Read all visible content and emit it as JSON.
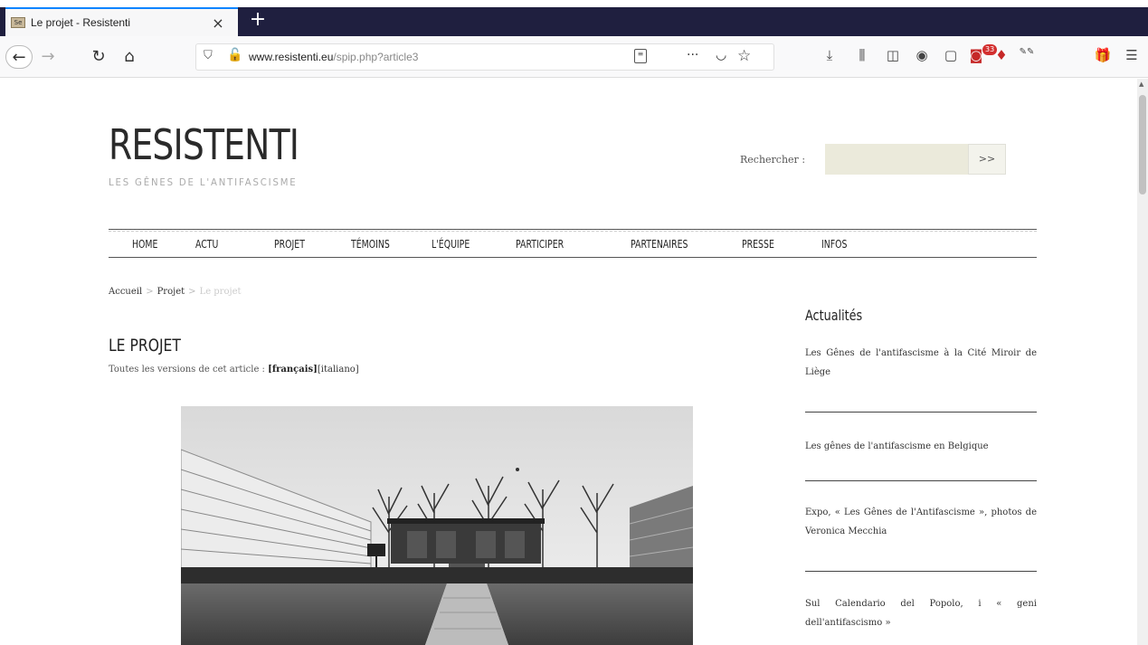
{
  "browser": {
    "tab_title": "Le projet - Resistenti",
    "favicon_text": "Se",
    "close_glyph": "×",
    "newtab_glyph": "+",
    "url_domain": "www.resistenti.eu",
    "url_path": "/spip.php?article3",
    "extension_badge": "33"
  },
  "site": {
    "logo": "RESISTENTI",
    "tagline": "LES GÊNES DE L'ANTIFASCISME",
    "search_label": "Rechercher :",
    "search_value": "",
    "search_button": ">>"
  },
  "menu": {
    "items": [
      "HOME",
      "ACTU",
      "PROJET",
      "TÉMOINS",
      "L'ÉQUIPE",
      "PARTICIPER",
      "PARTENAIRES",
      "PRESSE",
      "INFOS"
    ]
  },
  "breadcrumb": {
    "home": "Accueil",
    "section": "Projet",
    "current": "Le projet",
    "separator": ">"
  },
  "article": {
    "title": "LE PROJET",
    "versions_prefix": "Toutes les versions de cet article :",
    "version_fr": "[français]",
    "version_it": "[italiano]"
  },
  "sidebar": {
    "title": "Actualités",
    "news": [
      "Les Gênes de l'antifascisme à la Cité Miroir de Liège",
      "Les gênes de l'antifascisme en Belgique",
      "Expo, « Les Gênes de l'Antifascisme », photos de Veronica Mecchia",
      "Sul Calendario del Popolo, i « geni dell'antifascismo »"
    ]
  },
  "colors": {
    "tabstrip": "#1f1f3f",
    "search_field": "#ebeadb",
    "accent_tab": "#0a84ff"
  }
}
